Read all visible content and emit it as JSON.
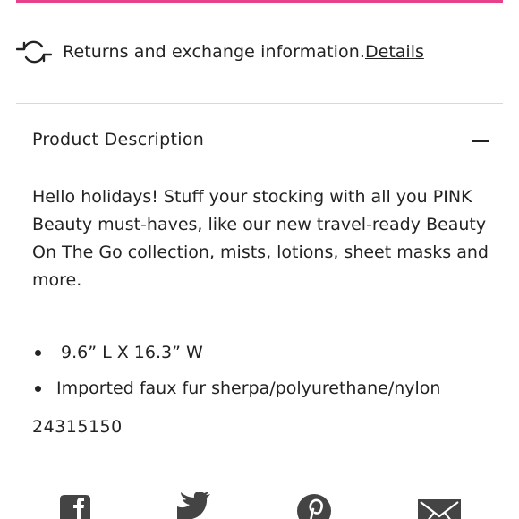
{
  "returns": {
    "text": "Returns and exchange information.",
    "link": "Details"
  },
  "product_description": {
    "title": "Product Description",
    "body": "Hello holidays! Stuff your stocking with all you PINK Beauty must-haves, like our new travel-ready Beauty On The Go collection, mists, lotions, sheet masks and more.",
    "bullets": [
      "9.6” L X 16.3” W",
      "Imported faux fur sherpa/polyurethane/nylon"
    ],
    "sku": "24315150"
  },
  "share": {
    "icons": [
      "facebook-icon",
      "twitter-icon",
      "pinterest-icon",
      "email-icon"
    ]
  },
  "colors": {
    "accent_pink": "#e8418c",
    "text": "#222222",
    "icon": "#444444",
    "divider": "#d8d8d8"
  }
}
